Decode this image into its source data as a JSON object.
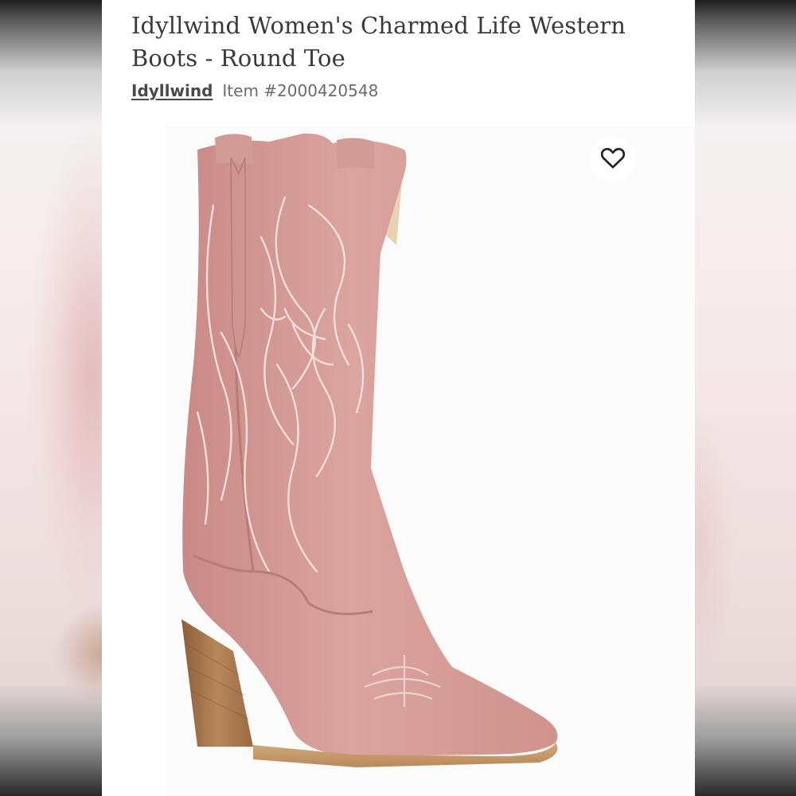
{
  "product": {
    "title": "Idyllwind Women's Charmed Life Western Boots - Round Toe",
    "brand": "Idyllwind",
    "item_number": "Item #2000420548"
  },
  "image": {
    "alt": "Pink suede western boot with white embroidery and stacked wooden heel"
  },
  "icons": {
    "wishlist": "heart-outline-icon"
  },
  "colors": {
    "boot": "#d49a94",
    "stitch": "#f6e6e2",
    "heel": "#a8784e",
    "title_text": "#3a3a3a"
  }
}
